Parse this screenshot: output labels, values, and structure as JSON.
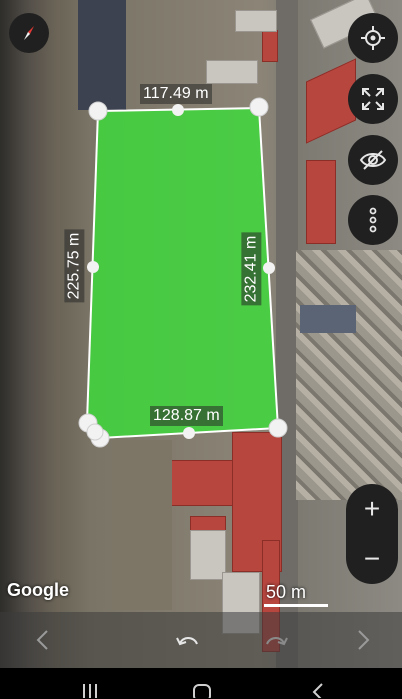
{
  "map": {
    "attribution": "Google",
    "scale_label": "50 m"
  },
  "measurements": {
    "top": "117.49 m",
    "left": "225.75 m",
    "right": "232.41 m",
    "bottom": "128.87 m"
  },
  "controls": {
    "compass_icon": "compass-icon",
    "locate_icon": "crosshair-icon",
    "fullscreen_icon": "expand-icon",
    "visibility_icon": "eye-off-icon",
    "more_icon": "more-vertical-icon",
    "zoom_in": "+",
    "zoom_out": "−"
  },
  "toolbar": {
    "back_icon": "chevron-left-icon",
    "undo_icon": "undo-icon",
    "redo_icon": "redo-icon",
    "forward_icon": "chevron-right-icon"
  },
  "colors": {
    "polygon_fill": "#3ddc3a",
    "polygon_stroke": "#ffffff",
    "button_bg": "#202020"
  }
}
